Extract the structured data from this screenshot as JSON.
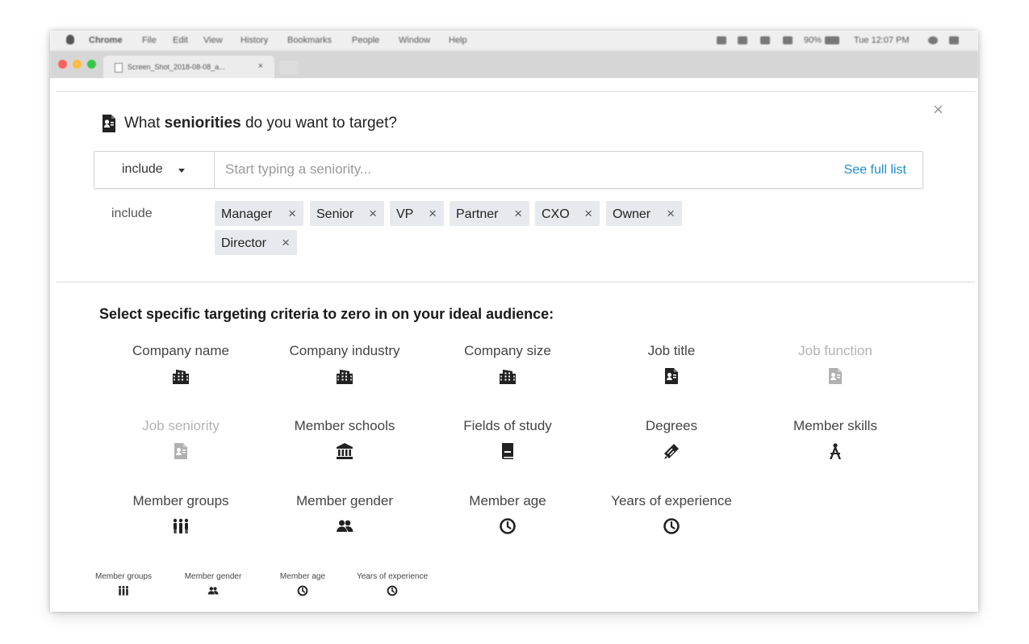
{
  "menubar": {
    "items": [
      "Chrome",
      "File",
      "Edit",
      "View",
      "History",
      "Bookmarks",
      "People",
      "Window",
      "Help"
    ],
    "battery": "90%",
    "clock": "Tue 12:07 PM"
  },
  "tab": {
    "title": "Screen_Shot_2018-08-08_a...",
    "close": "×"
  },
  "traffic_light_colors": [
    "#fc605b",
    "#fdbc40",
    "#34c84a"
  ],
  "dialog": {
    "close": "×",
    "question": {
      "prefix": "What ",
      "emphasis": "seniorities",
      "suffix": " do you want to target?",
      "icon": "id-card-icon"
    },
    "dropdown_value": "include",
    "search_placeholder": "Start typing a seniority...",
    "see_full_list": "See full list",
    "applied_label": "include",
    "pills": [
      "Manager",
      "Senior",
      "VP",
      "Partner",
      "CXO",
      "Owner",
      "Director"
    ],
    "pill_remove": "×"
  },
  "criteria": {
    "title": "Select specific targeting criteria to zero in on your ideal audience:",
    "items": [
      {
        "label": "Company name",
        "icon": "building-icon",
        "enabled": true
      },
      {
        "label": "Company industry",
        "icon": "building-icon",
        "enabled": true
      },
      {
        "label": "Company size",
        "icon": "building-icon",
        "enabled": true
      },
      {
        "label": "Job title",
        "icon": "id-card-icon",
        "enabled": true
      },
      {
        "label": "Job function",
        "icon": "id-card-icon",
        "enabled": false
      },
      {
        "label": "Job seniority",
        "icon": "id-card-icon",
        "enabled": false
      },
      {
        "label": "Member schools",
        "icon": "school-icon",
        "enabled": true
      },
      {
        "label": "Fields of study",
        "icon": "book-icon",
        "enabled": true
      },
      {
        "label": "Degrees",
        "icon": "diploma-icon",
        "enabled": true
      },
      {
        "label": "Member skills",
        "icon": "compass-icon",
        "enabled": true
      },
      {
        "label": "Member groups",
        "icon": "group-icon",
        "enabled": true
      },
      {
        "label": "Member gender",
        "icon": "people-icon",
        "enabled": true
      },
      {
        "label": "Member age",
        "icon": "clock-icon",
        "enabled": true
      },
      {
        "label": "Years of experience",
        "icon": "clock-icon",
        "enabled": true
      }
    ],
    "mini_items": [
      {
        "label": "Member groups",
        "icon": "group-icon"
      },
      {
        "label": "Member gender",
        "icon": "people-icon"
      },
      {
        "label": "Member age",
        "icon": "clock-icon"
      },
      {
        "label": "Years of experience",
        "icon": "clock-icon"
      }
    ]
  },
  "colors": {
    "link": "#1f8dd0",
    "pill_bg": "#e6eaee",
    "disabled_text": "#b3b3b3"
  }
}
